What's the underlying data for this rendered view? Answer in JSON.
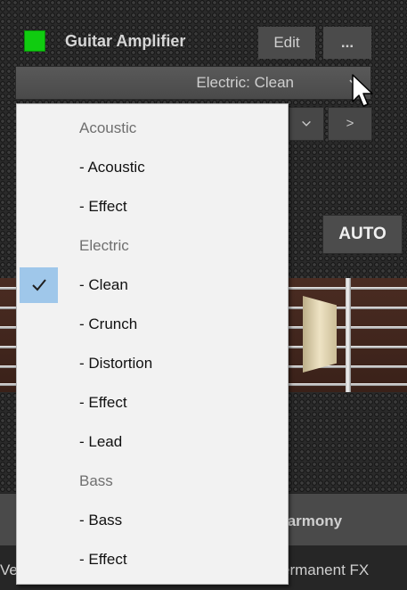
{
  "header": {
    "title": "Guitar Amplifier",
    "edit_label": "Edit",
    "more_label": "...",
    "power_color": "#10cc10"
  },
  "preset": {
    "selected": "Electric: Clean"
  },
  "controls": {
    "nav_next_label": ">",
    "auto_label": "AUTO"
  },
  "bottom": {
    "harmony_label": "larmony",
    "permanent_fx_label": "ermanent FX",
    "left_partial_label": "Ve"
  },
  "menu": {
    "items": [
      {
        "label": "Acoustic",
        "type": "header"
      },
      {
        "label": "- Acoustic",
        "type": "option"
      },
      {
        "label": "- Effect",
        "type": "option"
      },
      {
        "label": "Electric",
        "type": "header"
      },
      {
        "label": "- Clean",
        "type": "option",
        "checked": true
      },
      {
        "label": "- Crunch",
        "type": "option"
      },
      {
        "label": "- Distortion",
        "type": "option"
      },
      {
        "label": "- Effect",
        "type": "option"
      },
      {
        "label": "- Lead",
        "type": "option"
      },
      {
        "label": "Bass",
        "type": "header"
      },
      {
        "label": "- Bass",
        "type": "option"
      },
      {
        "label": "- Effect",
        "type": "option"
      }
    ],
    "check_icon": "checkmark-icon"
  }
}
